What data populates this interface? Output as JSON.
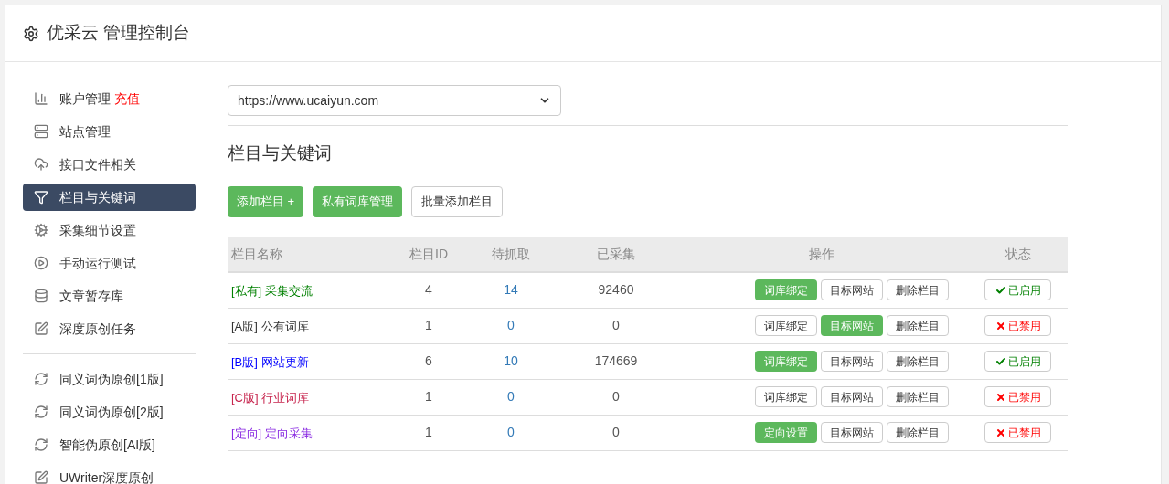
{
  "header": {
    "title": "优采云 管理控制台"
  },
  "sidebar": {
    "items": [
      {
        "kind": "chart",
        "label": "账户管理",
        "badge": "充值",
        "selected": false
      },
      {
        "kind": "server",
        "label": "站点管理",
        "selected": false
      },
      {
        "kind": "cloud",
        "label": "接口文件相关",
        "selected": false
      },
      {
        "kind": "filter",
        "label": "栏目与关键词",
        "selected": true
      },
      {
        "kind": "cogs",
        "label": "采集细节设置",
        "selected": false
      },
      {
        "kind": "play",
        "label": "手动运行测试",
        "selected": false
      },
      {
        "kind": "database",
        "label": "文章暂存库",
        "selected": false
      },
      {
        "kind": "edit",
        "label": "深度原创任务",
        "selected": false
      },
      {
        "kind": "divider"
      },
      {
        "kind": "refresh",
        "label": "同义词伪原创[1版]",
        "selected": false
      },
      {
        "kind": "refresh",
        "label": "同义词伪原创[2版]",
        "selected": false
      },
      {
        "kind": "refresh",
        "label": "智能伪原创[AI版]",
        "selected": false
      },
      {
        "kind": "edit",
        "label": "UWriter深度原创",
        "selected": false
      }
    ]
  },
  "site_select": {
    "value": "https://www.ucaiyun.com"
  },
  "section_title": "栏目与关键词",
  "toolbar": [
    {
      "label": "添加栏目 +",
      "kind": "primary"
    },
    {
      "label": "私有词库管理",
      "kind": "primary"
    },
    {
      "label": "批量添加栏目",
      "kind": "default"
    }
  ],
  "table": {
    "columns": [
      "栏目名称",
      "栏目ID",
      "待抓取",
      "已采集",
      "操作",
      "状态"
    ],
    "rows": [
      {
        "tag": "[私有]",
        "name": "采集交流",
        "color": "#008000",
        "id": "4",
        "pending": "14",
        "collected": "92460",
        "actions": [
          {
            "label": "词库绑定",
            "active": true
          },
          {
            "label": "目标网站",
            "active": false
          },
          {
            "label": "删除栏目",
            "active": false
          }
        ],
        "status": {
          "label": "已启用",
          "enabled": true
        }
      },
      {
        "tag": "[A版]",
        "name": "公有词库",
        "color": "#333333",
        "id": "1",
        "pending": "0",
        "collected": "0",
        "actions": [
          {
            "label": "词库绑定",
            "active": false
          },
          {
            "label": "目标网站",
            "active": true
          },
          {
            "label": "删除栏目",
            "active": false
          }
        ],
        "status": {
          "label": "已禁用",
          "enabled": false
        }
      },
      {
        "tag": "[B版]",
        "name": "网站更新",
        "color": "#0000ff",
        "id": "6",
        "pending": "10",
        "collected": "174669",
        "actions": [
          {
            "label": "词库绑定",
            "active": true
          },
          {
            "label": "目标网站",
            "active": false
          },
          {
            "label": "删除栏目",
            "active": false
          }
        ],
        "status": {
          "label": "已启用",
          "enabled": true
        }
      },
      {
        "tag": "[C版]",
        "name": "行业词库",
        "color": "#c7254e",
        "id": "1",
        "pending": "0",
        "collected": "0",
        "actions": [
          {
            "label": "词库绑定",
            "active": false
          },
          {
            "label": "目标网站",
            "active": false
          },
          {
            "label": "删除栏目",
            "active": false
          }
        ],
        "status": {
          "label": "已禁用",
          "enabled": false
        }
      },
      {
        "tag": "[定向]",
        "name": "定向采集",
        "color": "#8a2be2",
        "id": "1",
        "pending": "0",
        "collected": "0",
        "actions": [
          {
            "label": "定向设置",
            "active": true
          },
          {
            "label": "目标网站",
            "active": false
          },
          {
            "label": "删除栏目",
            "active": false
          }
        ],
        "status": {
          "label": "已禁用",
          "enabled": false
        }
      }
    ]
  }
}
